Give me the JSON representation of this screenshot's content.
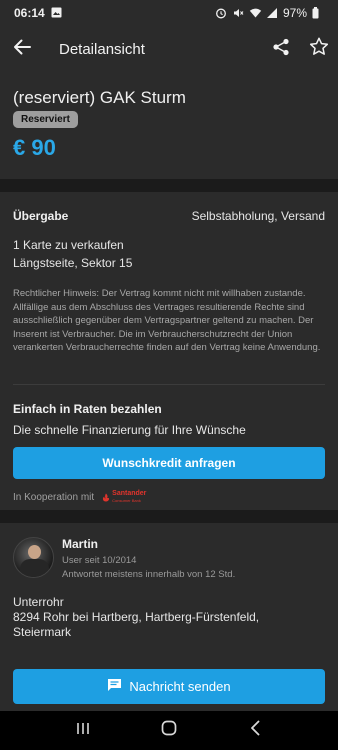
{
  "status_bar": {
    "time": "06:14",
    "battery": "97%",
    "icons": [
      "image-icon",
      "alarm-icon",
      "mute-icon",
      "wifi-icon",
      "signal-icon",
      "battery-icon"
    ]
  },
  "app_bar": {
    "title": "Detailansicht",
    "icons": [
      "back-arrow-icon",
      "share-icon",
      "star-icon"
    ]
  },
  "listing": {
    "title": "(reserviert) GAK Sturm",
    "badge": "Reserviert",
    "price": "€ 90"
  },
  "details": {
    "handover_label": "Übergabe",
    "handover_value": "Selbstabholung, Versand",
    "description_line1": "1 Karte zu verkaufen",
    "description_line2": "Längstseite, Sektor 15",
    "legal_notice": "Rechtlicher Hinweis: Der Vertrag kommt nicht mit willhaben zustande. Allfällige aus dem Abschluss des Vertrages resultierende Rechte sind ausschließlich gegenüber dem Vertragspartner geltend zu machen. Der Inserent ist Verbraucher. Die im Verbraucherschutzrecht der Union verankerten Verbraucherrechte finden auf den Vertrag keine Anwendung."
  },
  "financing": {
    "title": "Einfach in Raten bezahlen",
    "subtitle": "Die schnelle Finanzierung  für Ihre Wünsche",
    "button_label": "Wunschkredit anfragen",
    "cooperation_label": "In Kooperation mit",
    "partner_logo_line1": "Santander",
    "partner_logo_line2": "Consumer Bank"
  },
  "seller": {
    "name": "Martin",
    "member_since": "User seit 10/2014",
    "response_time": "Antwortet meistens innerhalb von 12 Std.",
    "location_line1": "Unterrohr",
    "location_line2": "8294 Rohr bei Hartberg, Hartberg-Fürstenfeld,",
    "location_line3": "Steiermark"
  },
  "bottom_action": {
    "button_label": "Nachricht senden",
    "icon": "chat-icon"
  },
  "navigation_bar": {
    "icons": [
      "recents-icon",
      "home-icon",
      "back-icon"
    ]
  },
  "colors": {
    "accent_blue": "#1e9fe2",
    "price_blue": "#2aa8e8",
    "surface": "#2b2b2b",
    "background": "#1b1b1b",
    "badge_gray": "#9e9e9e",
    "santander_red": "#e0342c"
  }
}
